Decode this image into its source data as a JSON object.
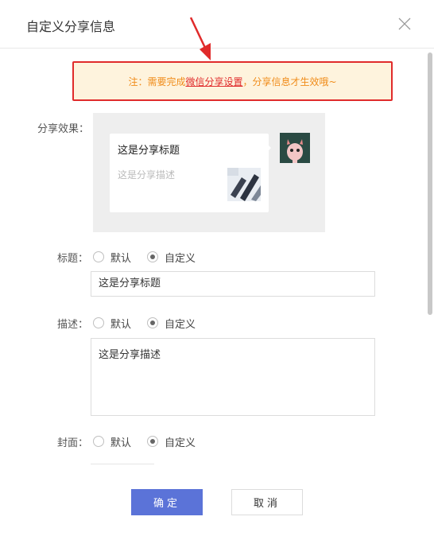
{
  "dialog": {
    "title": "自定义分享信息"
  },
  "notice": {
    "prefix": "注：需要完成",
    "link": "微信分享设置",
    "suffix": "，分享信息才生效哦~"
  },
  "preview": {
    "label": "分享效果：",
    "card_title": "这是分享标题",
    "card_desc": "这是分享描述"
  },
  "title_field": {
    "label": "标题：",
    "option_default": "默认",
    "option_custom": "自定义",
    "selected": "自定义",
    "value": "这是分享标题"
  },
  "desc_field": {
    "label": "描述：",
    "option_default": "默认",
    "option_custom": "自定义",
    "selected": "自定义",
    "value": "这是分享描述"
  },
  "cover_field": {
    "label": "封面：",
    "option_default": "默认",
    "option_custom": "自定义",
    "selected": "自定义"
  },
  "buttons": {
    "ok": "确定",
    "cancel": "取消"
  },
  "colors": {
    "accent": "#5b73d8",
    "notice_bg": "#fef3dd",
    "notice_text": "#f08c1a",
    "highlight_red": "#e02b2b"
  }
}
